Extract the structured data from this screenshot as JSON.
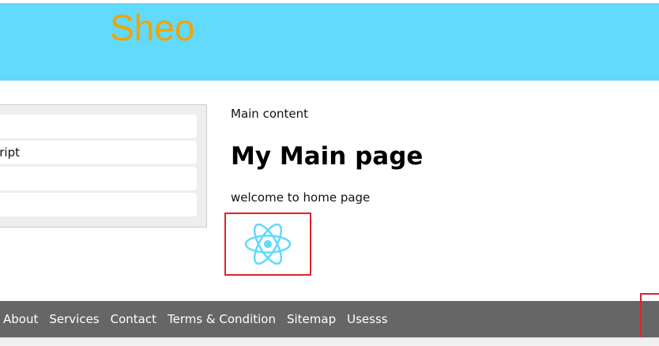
{
  "header": {
    "brand": "Sheo",
    "background_color": "#61dafb",
    "brand_color": "#f0a30a"
  },
  "sidebar": {
    "items": [
      {
        "label": ""
      },
      {
        "label": "cript"
      },
      {
        "label": ""
      },
      {
        "label": ""
      }
    ]
  },
  "main": {
    "label": "Main content",
    "title": "My Main page",
    "text": "welcome to home page",
    "logo_icon": "react-atom-icon",
    "logo_color": "#61dafb"
  },
  "footer": {
    "background_color": "#666666",
    "links": [
      {
        "label": "About"
      },
      {
        "label": "Services"
      },
      {
        "label": "Contact"
      },
      {
        "label": "Terms & Condition"
      },
      {
        "label": "Sitemap"
      },
      {
        "label": "Usesss"
      }
    ]
  }
}
